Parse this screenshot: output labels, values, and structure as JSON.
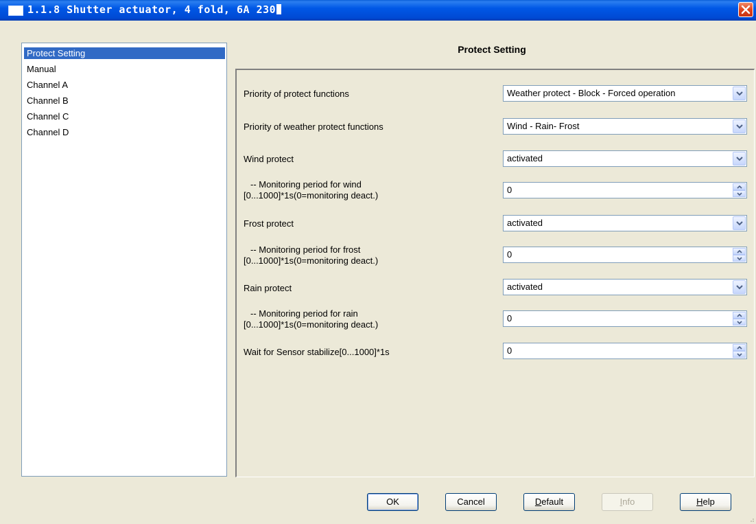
{
  "window": {
    "title": "1.1.8 Shutter actuator, 4 fold, 6A 230",
    "close_icon": "close-icon"
  },
  "nav": {
    "items": [
      {
        "label": "Protect Setting",
        "selected": true
      },
      {
        "label": "Manual",
        "selected": false
      },
      {
        "label": "Channel A",
        "selected": false
      },
      {
        "label": "Channel B",
        "selected": false
      },
      {
        "label": "Channel C",
        "selected": false
      },
      {
        "label": "Channel D",
        "selected": false
      }
    ]
  },
  "panel": {
    "title": "Protect Setting",
    "params": [
      {
        "label": "Priority of protect functions",
        "type": "combo",
        "value": "Weather protect - Block - Forced operation"
      },
      {
        "label": "Priority of weather protect functions",
        "type": "combo",
        "value": "Wind - Rain- Frost"
      },
      {
        "label": "Wind protect",
        "type": "combo",
        "value": "activated"
      },
      {
        "label_line1": "-- Monitoring period for wind",
        "label_line2": "[0...1000]*1s(0=monitoring deact.)",
        "type": "spin",
        "value": "0"
      },
      {
        "label": "Frost protect",
        "type": "combo",
        "value": "activated"
      },
      {
        "label_line1": "-- Monitoring period for frost",
        "label_line2": "[0...1000]*1s(0=monitoring deact.)",
        "type": "spin",
        "value": "0"
      },
      {
        "label": "Rain protect",
        "type": "combo",
        "value": "activated"
      },
      {
        "label_line1": "-- Monitoring period for rain",
        "label_line2": "[0...1000]*1s(0=monitoring deact.)",
        "type": "spin",
        "value": "0"
      },
      {
        "label": "Wait for Sensor stabilize[0...1000]*1s",
        "type": "spin",
        "value": "0"
      }
    ]
  },
  "buttons": {
    "ok": "OK",
    "cancel": "Cancel",
    "default_first": "D",
    "default_rest": "efault",
    "info_first": "I",
    "info_rest": "nfo",
    "help_first": "H",
    "help_rest": "elp"
  },
  "colors": {
    "title_bar": "#0054e3",
    "selection": "#316ac5",
    "dialog_background": "#ece9d8"
  }
}
